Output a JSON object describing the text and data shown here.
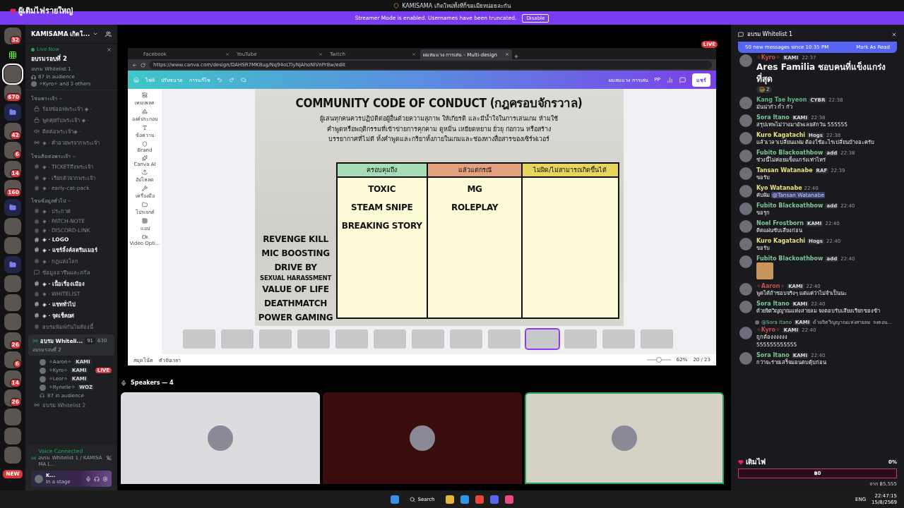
{
  "window": {
    "title": "KAMISAMA เกิดใหม่ทั้งทีก็ขอเมียหน่อยละกัน"
  },
  "overlay_title": "ผู้เติมไฟรายใหญ่",
  "banner": {
    "text": "Streamer Mode is enabled. Usernames have been truncated.",
    "button": "Disable"
  },
  "servers": [
    {
      "kind": "avatar",
      "badge": "32",
      "selected": false
    },
    {
      "kind": "logo",
      "selected": false
    },
    {
      "kind": "avatar",
      "selected": true
    },
    {
      "kind": "avatar",
      "badge": "670",
      "selected": false
    },
    {
      "kind": "folder",
      "selected": false
    },
    {
      "kind": "avatar",
      "badge": "42",
      "selected": false
    },
    {
      "kind": "avatar",
      "badge": "6",
      "selected": false
    },
    {
      "kind": "avatar",
      "badge": "14",
      "selected": false
    },
    {
      "kind": "avatar",
      "badge": "160",
      "selected": false
    },
    {
      "kind": "folder",
      "selected": false
    },
    {
      "kind": "avatar",
      "selected": false
    },
    {
      "kind": "avatar",
      "selected": false
    },
    {
      "kind": "folder",
      "selected": false
    },
    {
      "kind": "avatar",
      "selected": false
    },
    {
      "kind": "avatar",
      "selected": false
    },
    {
      "kind": "avatar",
      "selected": false
    },
    {
      "kind": "avatar",
      "badge": "26",
      "selected": false
    },
    {
      "kind": "avatar",
      "badge": "6",
      "selected": false
    },
    {
      "kind": "avatar",
      "badge": "14",
      "selected": false
    },
    {
      "kind": "avatar",
      "badge": "26",
      "selected": false
    },
    {
      "kind": "avatar",
      "selected": false
    },
    {
      "kind": "avatar",
      "selected": false
    },
    {
      "kind": "avatar",
      "selected": false
    },
    {
      "kind": "new",
      "badge": "NEW",
      "selected": false
    }
  ],
  "sidebar": {
    "server_name": "KAMISAMA เกิดใ...",
    "live": {
      "label": "Live Now",
      "title": "อบรมรอบที่ 2",
      "channel": "อบรม Whitelist 1",
      "audience": "87 in audience",
      "people": "✧Kyro✧ and 3 others"
    },
    "categories": [
      {
        "name": "โซนพระเจ้า",
        "channels": [
          {
            "kind": "locked",
            "name": "ร้อยช่ออฟพระเจ้า ◈ ·",
            "unread": false
          },
          {
            "kind": "locked",
            "name": "พูดคุยกับพระเจ้า ◈ ·",
            "unread": false
          },
          {
            "kind": "voice",
            "name": "ติดต่อพระเจ้า◈ ·",
            "unread": false
          },
          {
            "kind": "stage",
            "name": "◈ · คำอวยพรจากพระเจ้า",
            "unread": false
          }
        ]
      },
      {
        "name": "โซนติดต่อพระเจ้า",
        "channels": [
          {
            "kind": "text",
            "name": "◈ · TICKETถึงพระเจ้า",
            "unread": false
          },
          {
            "kind": "text",
            "name": "◈ · เรียกตัวจากพระเจ้า",
            "unread": false
          },
          {
            "kind": "text",
            "name": "◈ · early-cat-pack",
            "unread": false
          }
        ]
      },
      {
        "name": "โซนข้อมูลทั่วไป",
        "channels": [
          {
            "kind": "text",
            "name": "◈ · ประกาศ",
            "unread": false
          },
          {
            "kind": "text",
            "name": "◈ · PATCH-NOTE",
            "unread": false
          },
          {
            "kind": "text",
            "name": "◈ · DISCORD-LINK",
            "unread": false
          },
          {
            "kind": "text",
            "name": "◈ · LOGO",
            "unread": true
          },
          {
            "kind": "text",
            "name": "◈ · แชร์ลิ้งค์สตรีมเมอร์",
            "unread": true
          },
          {
            "kind": "text",
            "name": "◈ · กฎแห่งโลก",
            "unread": false
          },
          {
            "kind": "forum",
            "name": "ข้อมูลอาชีพและสกิล",
            "unread": false
          },
          {
            "kind": "text",
            "name": "◈ · เนื้อเรื่องเมือง",
            "unread": true
          },
          {
            "kind": "text",
            "name": "◈ · WHITELIST",
            "unread": false
          },
          {
            "kind": "text",
            "name": "◈ · แชททั่วไป",
            "unread": true
          },
          {
            "kind": "text",
            "name": "◈ · จุดเช็คยศ",
            "unread": true
          },
          {
            "kind": "text",
            "name": "อบรมพิมพ์กันในห้องนี้",
            "unread": false
          }
        ]
      }
    ],
    "stage": {
      "name": "อบรม Whiteli...",
      "topic": "อบรมรอบที่ 2",
      "count": "91",
      "listeners": "630",
      "members": [
        {
          "name": "✧Aaron✧",
          "tag": "KAMI",
          "live": false
        },
        {
          "name": "✧Kyro✧",
          "tag": "KAMI",
          "live": true,
          "live_label": "LIVE"
        },
        {
          "name": "✧Leor✧",
          "tag": "KAMI",
          "live": false
        },
        {
          "name": "✧Rynelle✧",
          "tag": "WOZ",
          "live": false
        }
      ],
      "audience": "87 in audience"
    },
    "other_stage": "อบรม Whitelist 2",
    "voice": {
      "status": "Voice Connected",
      "channel": "อบรม Whitelist 1 / KAMISAMA L...",
      "user": "K...",
      "user_status": "In a stage"
    }
  },
  "stream": {
    "live_badge": "LIVE",
    "tabs": [
      {
        "label": "Facebook",
        "selected": false
      },
      {
        "label": "YouTube",
        "selected": false
      },
      {
        "label": "Twitch",
        "selected": false
      },
      {
        "label": "ผมสมแวง การเล่น - Multi-design",
        "selected": true
      }
    ],
    "url": "https://www.canva.com/design/DAHSR7MK8ug/Nq94oLTIyNjAhoNlVnPr8w/edit",
    "canva_menu": [
      "ไฟล์",
      "ปรับขนาด",
      "การแก้ไข"
    ],
    "canva_title": "ผมสมแวง การเล่น",
    "canva_user": "PP",
    "share": "แชร์",
    "canva_tools": [
      "เทมเพลต",
      "องค์ประกอบ",
      "ข้อความ",
      "Brand",
      "Canva AI",
      "อัปโหลด",
      "เครื่องมือ",
      "โปรเจกต์",
      "แอป",
      "Video Opti..."
    ],
    "slide": {
      "title": "COMMUNITY CODE OF CONDUCT (กฎครอบจักรวาล)",
      "intro": "ผู้เล่นทุกคนควรปฏิบัติต่อผู้อื่นด้วยความสุภาพ ให้เกียรติ และมีน้ำใจในการเล่นเกม ห้ามใช้คำพูดหรือพฤติกรรมที่เข้าข่ายการคุกคาม ดูหมิ่น เหยียดหยาม ยั่วยุ ก่อกวน หรือสร้างบรรยากาศที่ไม่ดี ทั้งคำพูดและกริยาทั้งภายในเกมและช่องทางสื่อสารของเซิร์ฟเวอร์",
      "pending": [
        "REVENGE KILL",
        "MIC BOOSTING",
        "DRIVE BY",
        "SEXUAL HARASSMENT",
        "VALUE OF LIFE",
        "DEATHMATCH",
        "POWER GAMING"
      ],
      "columns": [
        {
          "heading": "ครอบคุมถึง",
          "color": "#a6dcb6",
          "items": [
            "TOXIC",
            "STEAM SNIPE",
            "BREAKING STORY"
          ]
        },
        {
          "heading": "แล้วแต่กรณี",
          "color": "#e3a07e",
          "items": [
            "MG",
            "ROLEPLAY"
          ]
        },
        {
          "heading": "ไม่ผิด/ไม่สามารถเกิดขึ้นได้",
          "color": "#e6d65e"
        }
      ]
    },
    "thumbnails": [
      {
        "selected": false
      },
      {
        "selected": false
      },
      {
        "selected": false
      },
      {
        "selected": false
      },
      {
        "selected": false
      },
      {
        "selected": false
      },
      {
        "selected": false
      },
      {
        "selected": false
      },
      {
        "selected": false
      },
      {
        "selected": true
      },
      {
        "selected": false
      },
      {
        "selected": false
      },
      {
        "selected": false
      }
    ],
    "notes": "สมุดโน้ต",
    "timer": "ตัวจับเวลา",
    "zoom_slider": {
      "level": 0.5
    },
    "zoom": "62%",
    "page": "20 / 23"
  },
  "speakers": {
    "heading": "Speakers — 4",
    "tiles": [
      {
        "speaking": false
      },
      {
        "speaking": false
      },
      {
        "speaking": true
      }
    ]
  },
  "chat": {
    "title": "อบรม Whitelist 1",
    "new_messages": "50 new messages since 10:35 PM",
    "mark_read": "Mark As Read",
    "messages": [
      {
        "kind": "big",
        "name": "✧Kyro✧",
        "color": "#c0504d",
        "tag": "KAMI",
        "time": "22:37",
        "text": "Ares Familia ชอบคนที่แข็งแกร่งที่สุด",
        "reaction": "2"
      },
      {
        "kind": "text",
        "name": "Kang Tae hyeon",
        "color": "#5fb38a",
        "tag": "CYBR",
        "time": "22:38",
        "text": "มันน่ากัว กั๋ว กัว"
      },
      {
        "kind": "text",
        "name": "Sora Itano",
        "color": "#7cc49a",
        "tag": "KAMI",
        "time": "22:38",
        "text": "สรุปเทพไม่ว่างมาอัพเลยสักวัน 555555"
      },
      {
        "kind": "text",
        "name": "Kuro Kagatachi",
        "color": "#e6e07a",
        "tag": "Hogs",
        "time": "22:38",
        "text": "แล้วเวลาเปลี่ยนแฟม ต้องใช้อะไรเปลี่ยนบ้างอะครับ"
      },
      {
        "kind": "text",
        "name": "Fubito Blackoathbow",
        "color": "#7cc49a",
        "tag": "add",
        "time": "22:38",
        "text": "ช่วงนี้ไม่ค่อยแข็งแกร่งเท่าไหร่"
      },
      {
        "kind": "text",
        "name": "Tansan Watanabe",
        "color": "#e6e07a",
        "tag": "RAF",
        "time": "22:39",
        "text": "ขอรับ"
      },
      {
        "kind": "mention",
        "name": "Kyo Watanabe",
        "color": "#e6e07a",
        "time": "22:40",
        "text": "คับผ้ม",
        "mention": "@Tansan Watanabe"
      },
      {
        "kind": "text",
        "name": "Fubito Blackoathbow",
        "color": "#7cc49a",
        "tag": "add",
        "time": "22:40",
        "text": "ขอรุก"
      },
      {
        "kind": "text",
        "name": "Noel Frostborn",
        "color": "#7cc49a",
        "tag": "KAMI",
        "time": "22:40",
        "text": "ติดแผ่นซับเสียงก่อน"
      },
      {
        "kind": "text",
        "name": "Kuro Kagatachi",
        "color": "#e6e07a",
        "tag": "Hogs",
        "time": "22:40",
        "text": "ขอรับ"
      },
      {
        "kind": "image",
        "name": "Fubito Blackoathbow",
        "color": "#7cc49a",
        "tag": "add",
        "time": "22:40"
      },
      {
        "kind": "text",
        "name": "✧Aaron✧",
        "color": "#c0504d",
        "tag": "KAMI",
        "time": "22:40",
        "text": "พูดได้ถ้าชอบจริงๆ แต่แค่ว่าไม่จำเป็นนะ"
      },
      {
        "kind": "text",
        "name": "Sora Itano",
        "color": "#7cc49a",
        "tag": "KAMI",
        "time": "22:40",
        "text": "ด้วยจิตวิญญาณแห่งสายลม จงตอบรับเสียงเรียกของข้า"
      },
      {
        "kind": "reply",
        "reply_to": "@Sora Itano",
        "reply_tag": "KAMI",
        "reply_text": "ด้วยจิตวิญญาณแห่งสายลม จงตอบ...",
        "name": "✧Kyro✧",
        "color": "#c0504d",
        "tag": "KAMI",
        "time": "22:40",
        "text": "ถูกต้องงงงงง",
        "text2": "555555555555"
      },
      {
        "kind": "text",
        "name": "Sora Itano",
        "color": "#7cc49a",
        "tag": "KAMI",
        "time": "22:40",
        "text": "กว่าจะร่ายเสร็จมอนตบตุ้บก่อน"
      }
    ]
  },
  "goal": {
    "title": "เติมไฟ",
    "percent": "0%",
    "amount": "฿0",
    "target": "จาก ฿5,555",
    "level": 0
  },
  "taskbar": {
    "search": "Search",
    "language": "ENG",
    "time": "22:47:15",
    "date": "15/8/2569"
  }
}
